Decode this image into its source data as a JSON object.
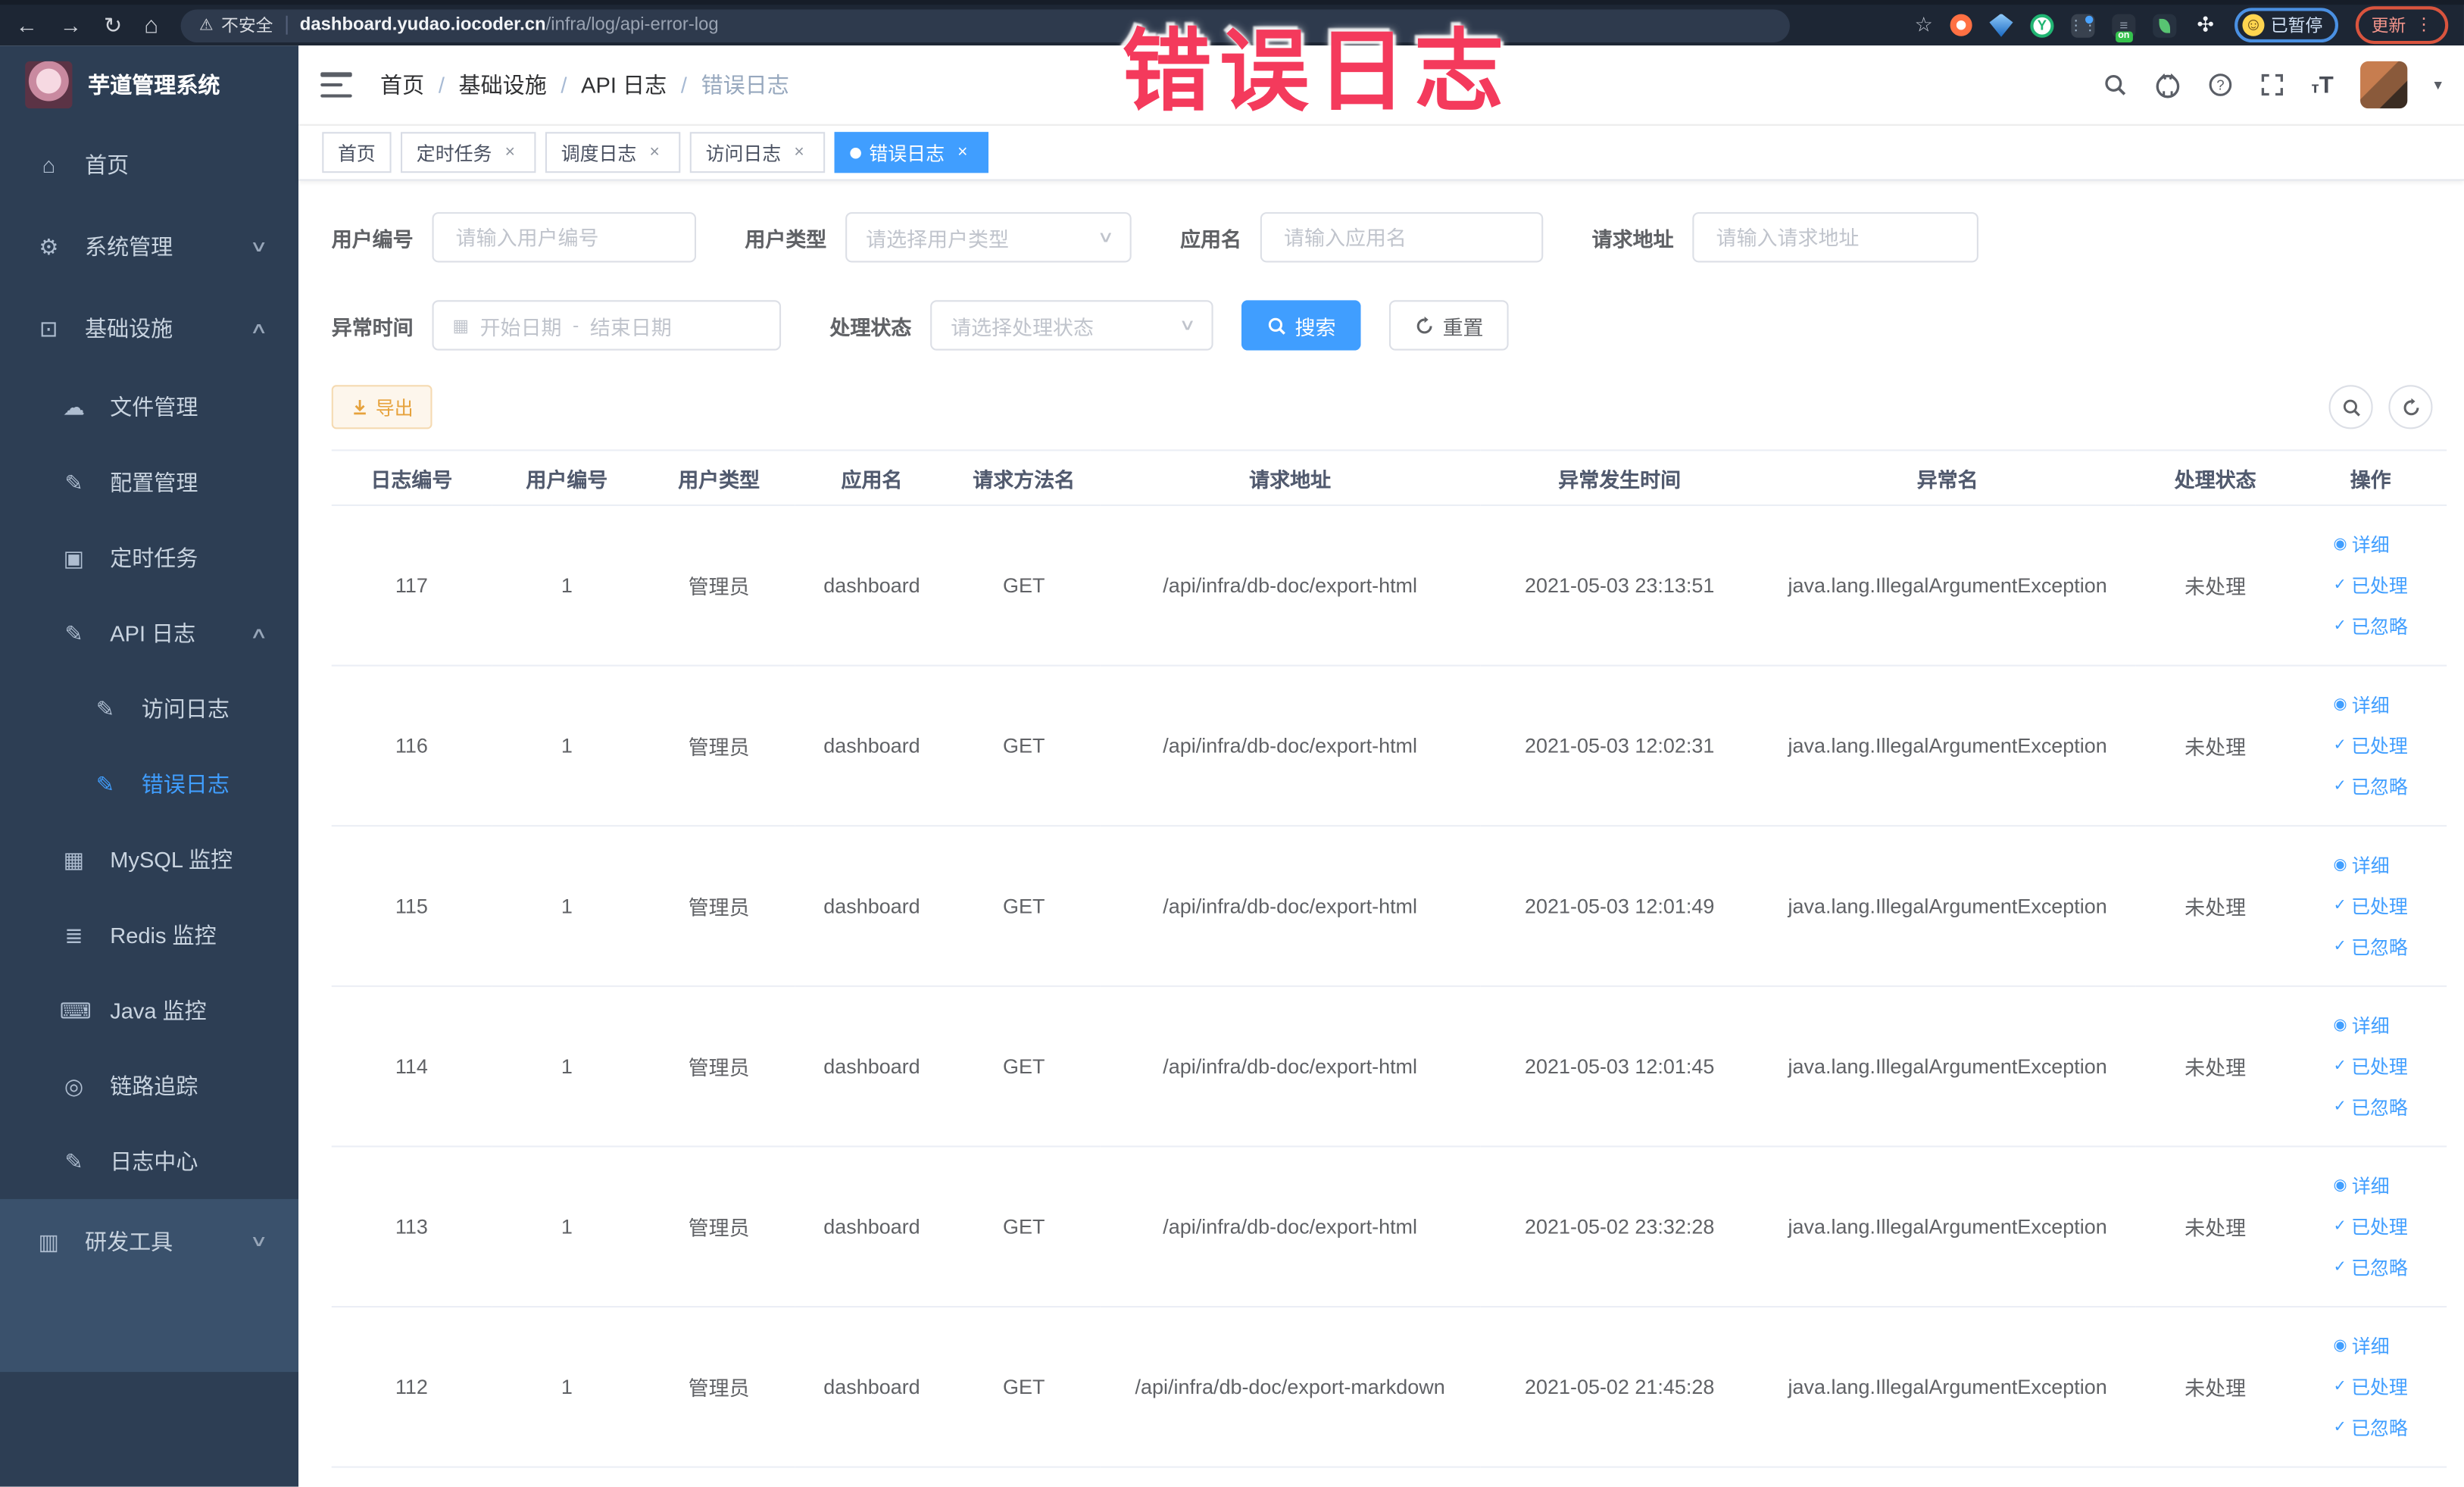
{
  "browser": {
    "security_label": "不安全",
    "url_host": "dashboard.yudao.iocoder.cn",
    "url_path": "/infra/log/api-error-log",
    "paused_label": "已暂停",
    "update_label": "更新"
  },
  "watermark": "错误日志",
  "icons": {
    "back": "←",
    "forward": "→",
    "reload": "↻",
    "home": "⌂",
    "warning": "⚠",
    "star": "☆",
    "kebab": "⋮",
    "smiley": "☺",
    "close": "×",
    "caret_down": "∨",
    "chevron_up": "∧",
    "chevron_down": "∨",
    "calendar": "▦",
    "eye": "◉",
    "check": "✓",
    "avatar_caret": "▾",
    "grid_glyph": "⋮⋮"
  },
  "sidebar": {
    "logo_title": "芋道管理系统",
    "items": [
      {
        "glyph": "⌂",
        "label": "首页"
      },
      {
        "glyph": "⚙",
        "label": "系统管理"
      },
      {
        "glyph": "⊡",
        "label": "基础设施"
      },
      {
        "glyph": "☁",
        "label": "文件管理"
      },
      {
        "glyph": "✎",
        "label": "配置管理"
      },
      {
        "glyph": "▣",
        "label": "定时任务"
      },
      {
        "glyph": "✎",
        "label": "API 日志"
      },
      {
        "glyph": "✎",
        "label": "访问日志"
      },
      {
        "glyph": "✎",
        "label": "错误日志"
      },
      {
        "glyph": "▦",
        "label": "MySQL 监控"
      },
      {
        "glyph": "≣",
        "label": "Redis 监控"
      },
      {
        "glyph": "⌨",
        "label": "Java 监控"
      },
      {
        "glyph": "◎",
        "label": "链路追踪"
      },
      {
        "glyph": "✎",
        "label": "日志中心"
      },
      {
        "glyph": "▥",
        "label": "研发工具"
      }
    ]
  },
  "breadcrumb": {
    "separator": "/",
    "items": [
      "首页",
      "基础设施",
      "API 日志",
      "错误日志"
    ]
  },
  "tabs": [
    {
      "label": "首页"
    },
    {
      "label": "定时任务"
    },
    {
      "label": "调度日志"
    },
    {
      "label": "访问日志"
    },
    {
      "label": "错误日志"
    }
  ],
  "filters": {
    "user_id": {
      "label": "用户编号",
      "placeholder": "请输入用户编号"
    },
    "user_type": {
      "label": "用户类型",
      "placeholder": "请选择用户类型"
    },
    "app_name": {
      "label": "应用名",
      "placeholder": "请输入应用名"
    },
    "request_url": {
      "label": "请求地址",
      "placeholder": "请输入请求地址"
    },
    "exception_time": {
      "label": "异常时间",
      "start_placeholder": "开始日期",
      "separator": "-",
      "end_placeholder": "结束日期"
    },
    "process_status": {
      "label": "处理状态",
      "placeholder": "请选择处理状态"
    },
    "search_label": "搜索",
    "reset_label": "重置"
  },
  "toolbar": {
    "export_label": "导出"
  },
  "table": {
    "columns": [
      "日志编号",
      "用户编号",
      "用户类型",
      "应用名",
      "请求方法名",
      "请求地址",
      "异常发生时间",
      "异常名",
      "处理状态",
      "操作"
    ],
    "actions": {
      "detail": "详细",
      "processed": "已处理",
      "ignored": "已忽略"
    },
    "rows": [
      {
        "id": "117",
        "user_id": "1",
        "user_type": "管理员",
        "app": "dashboard",
        "method": "GET",
        "url": "/api/infra/db-doc/export-html",
        "time": "2021-05-03 23:13:51",
        "exception": "java.lang.IllegalArgumentException",
        "status": "未处理"
      },
      {
        "id": "116",
        "user_id": "1",
        "user_type": "管理员",
        "app": "dashboard",
        "method": "GET",
        "url": "/api/infra/db-doc/export-html",
        "time": "2021-05-03 12:02:31",
        "exception": "java.lang.IllegalArgumentException",
        "status": "未处理"
      },
      {
        "id": "115",
        "user_id": "1",
        "user_type": "管理员",
        "app": "dashboard",
        "method": "GET",
        "url": "/api/infra/db-doc/export-html",
        "time": "2021-05-03 12:01:49",
        "exception": "java.lang.IllegalArgumentException",
        "status": "未处理"
      },
      {
        "id": "114",
        "user_id": "1",
        "user_type": "管理员",
        "app": "dashboard",
        "method": "GET",
        "url": "/api/infra/db-doc/export-html",
        "time": "2021-05-03 12:01:45",
        "exception": "java.lang.IllegalArgumentException",
        "status": "未处理"
      },
      {
        "id": "113",
        "user_id": "1",
        "user_type": "管理员",
        "app": "dashboard",
        "method": "GET",
        "url": "/api/infra/db-doc/export-html",
        "time": "2021-05-02 23:32:28",
        "exception": "java.lang.IllegalArgumentException",
        "status": "未处理"
      },
      {
        "id": "112",
        "user_id": "1",
        "user_type": "管理员",
        "app": "dashboard",
        "method": "GET",
        "url": "/api/infra/db-doc/export-markdown",
        "time": "2021-05-02 21:45:28",
        "exception": "java.lang.IllegalArgumentException",
        "status": "未处理"
      }
    ]
  }
}
